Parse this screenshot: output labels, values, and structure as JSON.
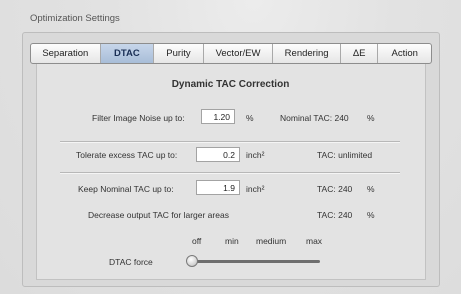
{
  "group_title": "Optimization Settings",
  "tabs": [
    {
      "label": "Separation",
      "active": false
    },
    {
      "label": "DTAC",
      "active": true
    },
    {
      "label": "Purity",
      "active": false
    },
    {
      "label": "Vector/EW",
      "active": false
    },
    {
      "label": "Rendering",
      "active": false
    },
    {
      "label": "ΔE",
      "active": false
    },
    {
      "label": "Action",
      "active": false
    }
  ],
  "heading": "Dynamic TAC Correction",
  "filter_noise": {
    "label": "Filter Image Noise up to:",
    "value": "1.20",
    "unit": "%",
    "nominal": "Nominal TAC: 240",
    "nominal_unit": "%"
  },
  "tolerate_excess": {
    "label": "Tolerate excess TAC up to:",
    "value": "0.2",
    "unit": "inch²",
    "info": "TAC: unlimited"
  },
  "keep_nominal": {
    "label": "Keep Nominal TAC up to:",
    "value": "1.9",
    "unit": "inch²",
    "info": "TAC: 240",
    "info_unit": "%"
  },
  "decrease_output": {
    "label": "Decrease output TAC for larger areas",
    "info": "TAC: 240",
    "info_unit": "%"
  },
  "dtac_force": {
    "label": "DTAC force",
    "scale": [
      "off",
      "min",
      "medium",
      "max"
    ],
    "selected": "off"
  }
}
